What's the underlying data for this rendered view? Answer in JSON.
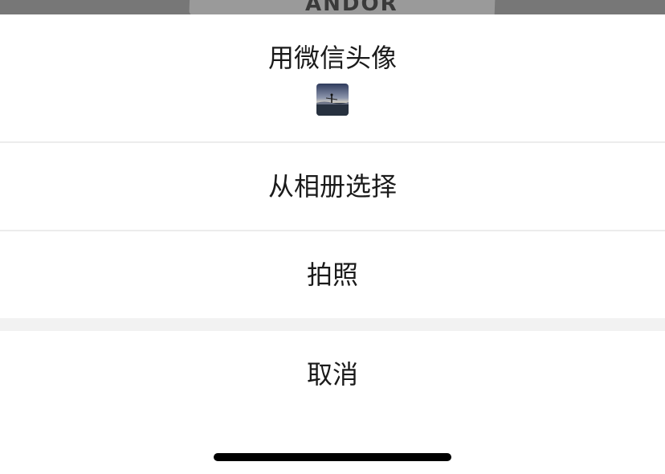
{
  "background": {
    "partial_label": "ANDOR"
  },
  "action_sheet": {
    "use_wechat_avatar_label": "用微信头像",
    "choose_from_album_label": "从相册选择",
    "take_photo_label": "拍照",
    "cancel_label": "取消"
  },
  "colors": {
    "sheet_bg": "#ffffff",
    "separator": "#ececec",
    "group_gap": "#f2f2f2",
    "text": "#1a1a1a"
  }
}
